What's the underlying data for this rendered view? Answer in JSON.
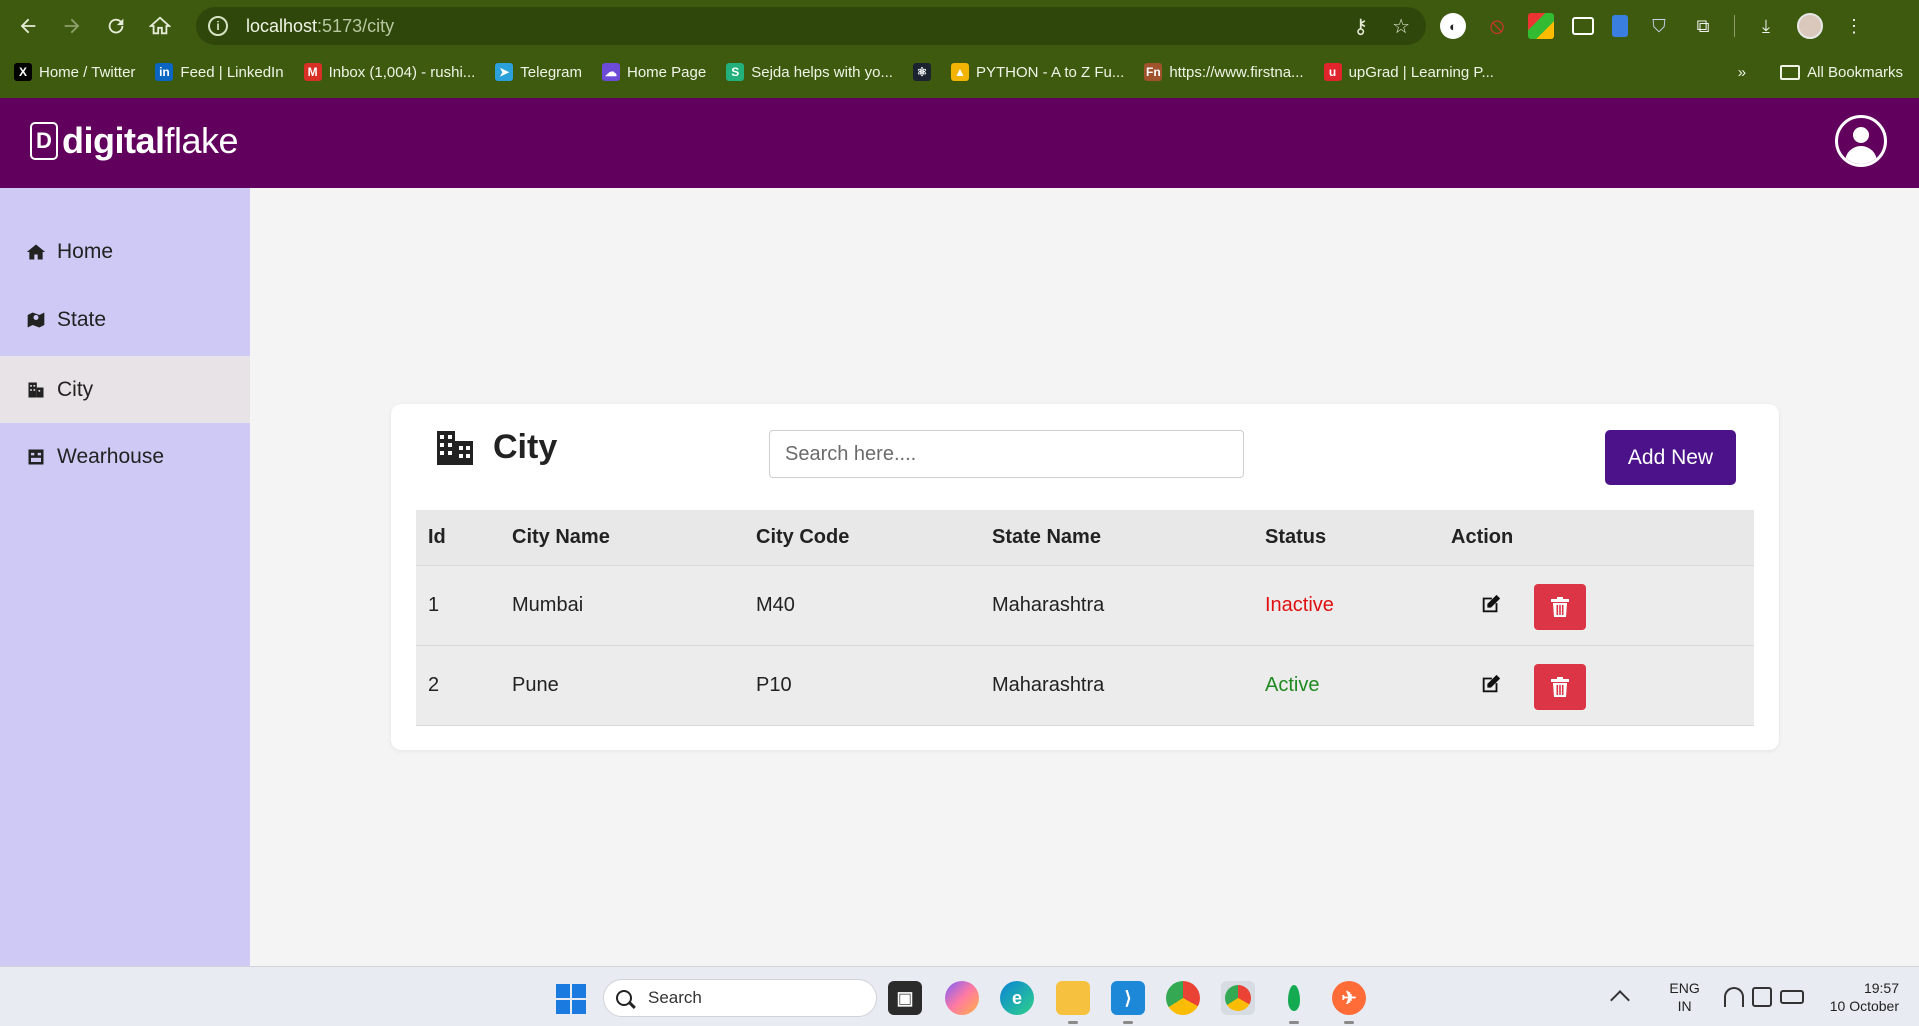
{
  "browser": {
    "url_host": "localhost",
    "url_path": ":5173/city",
    "bookmarks": [
      {
        "label": "Home / Twitter",
        "icon": "x-icon",
        "color": "#000000",
        "glyph": "X"
      },
      {
        "label": "Feed | LinkedIn",
        "icon": "linkedin-icon",
        "color": "#0a66c2",
        "glyph": "in"
      },
      {
        "label": "Inbox (1,004) - rushi...",
        "icon": "gmail-icon",
        "color": "#d93025",
        "glyph": "M"
      },
      {
        "label": "Telegram",
        "icon": "telegram-icon",
        "color": "#2aa1da",
        "glyph": "➤"
      },
      {
        "label": "Home Page",
        "icon": "cloud-icon",
        "color": "#6b4bd8",
        "glyph": "☁"
      },
      {
        "label": "Sejda helps with yo...",
        "icon": "sejda-icon",
        "color": "#22b07d",
        "glyph": "S"
      },
      {
        "label": "",
        "icon": "react-icon",
        "color": "#1b2330",
        "glyph": "⚛"
      },
      {
        "label": "PYTHON - A to Z Fu...",
        "icon": "drive-icon",
        "color": "#f2b400",
        "glyph": "▲"
      },
      {
        "label": "https://www.firstna...",
        "icon": "fn-icon",
        "color": "#a0522d",
        "glyph": "Fn"
      },
      {
        "label": "upGrad | Learning P...",
        "icon": "upgrad-icon",
        "color": "#e0252d",
        "glyph": "u"
      }
    ],
    "more_bookmarks_glyph": "»",
    "all_bookmarks_label": "All Bookmarks"
  },
  "app": {
    "logo_mark": "D",
    "logo_bold": "digital",
    "logo_light": "flake",
    "header_color": "#62005e"
  },
  "sidebar": {
    "items": [
      {
        "label": "Home",
        "icon": "home-icon"
      },
      {
        "label": "State",
        "icon": "map-icon"
      },
      {
        "label": "City",
        "icon": "city-icon",
        "active": true
      },
      {
        "label": "Wearhouse",
        "icon": "warehouse-icon"
      }
    ]
  },
  "page": {
    "title": "City",
    "search_placeholder": "Search here....",
    "add_button": "Add New",
    "add_button_color": "#4b1289"
  },
  "table": {
    "columns": [
      "Id",
      "City Name",
      "City Code",
      "State Name",
      "Status",
      "Action"
    ],
    "rows": [
      {
        "id": "1",
        "city_name": "Mumbai",
        "city_code": "M40",
        "state_name": "Maharashtra",
        "status": "Inactive"
      },
      {
        "id": "2",
        "city_name": "Pune",
        "city_code": "P10",
        "state_name": "Maharashtra",
        "status": "Active"
      }
    ]
  },
  "taskbar": {
    "search_label": "Search",
    "lang_line1": "ENG",
    "lang_line2": "IN",
    "time": "19:57",
    "date": "10 October"
  }
}
